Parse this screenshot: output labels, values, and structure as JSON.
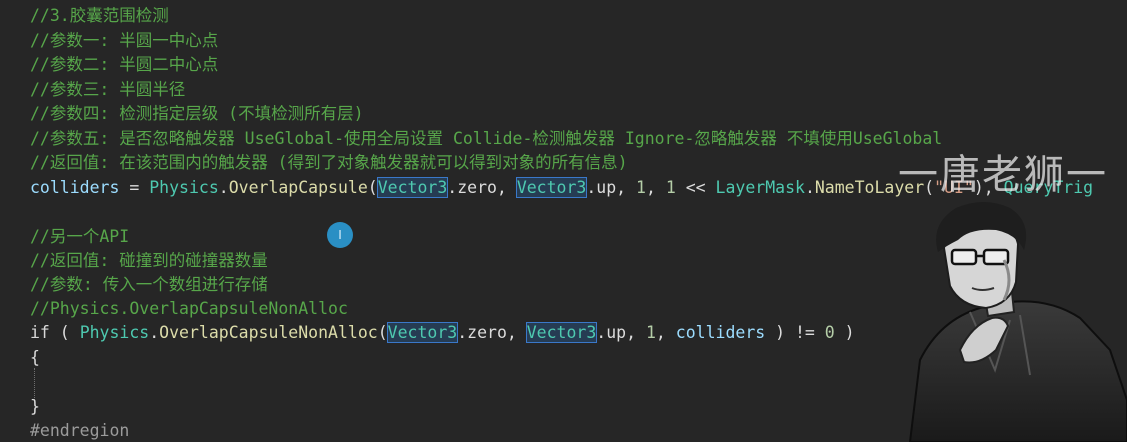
{
  "code": {
    "l1": "//3.胶囊范围检测",
    "l2": "//参数一: 半圆一中心点",
    "l3": "//参数二: 半圆二中心点",
    "l4": "//参数三: 半圆半径",
    "l5": "//参数四: 检测指定层级 (不填检测所有层)",
    "l6": "//参数五: 是否忽略触发器 UseGlobal-使用全局设置 Collide-检测触发器 Ignore-忽略触发器 不填使用UseGlobal",
    "l7": "//返回值: 在该范围内的触发器 (得到了对象触发器就可以得到对象的所有信息)",
    "l8": {
      "colliders": "colliders",
      "eq": " = ",
      "physics": "Physics",
      "dot1": ".",
      "method": "OverlapCapsule",
      "paren": "(",
      "vec1": "Vector3",
      "zero": ".zero, ",
      "vec2": "Vector3",
      "up": ".up, ",
      "num1": "1",
      "sep1": ", ",
      "num2": "1",
      "shift": " << ",
      "layermask": "LayerMask",
      "dot2": ".",
      "nametolayer": "NameToLayer",
      "paren2": "(",
      "str": "\"UI\"",
      "tail": "), ",
      "querytrig": "QueryTrig"
    },
    "l10": "//另一个API",
    "l11": "//返回值: 碰撞到的碰撞器数量",
    "l12": "//参数: 传入一个数组进行存储",
    "l13": "//Physics.OverlapCapsuleNonAlloc",
    "l14": {
      "if": "if",
      "open": " ( ",
      "physics": "Physics",
      "dot1": ".",
      "method": "OverlapCapsuleNonAlloc",
      "paren": "(",
      "vec1": "Vector3",
      "zero": ".zero, ",
      "vec2": "Vector3",
      "up": ".up, ",
      "num1": "1",
      "sep": ", ",
      "colliders": "colliders",
      "neq": " ) != ",
      "num0": "0",
      "close": " )"
    },
    "l15": "{",
    "l16": "}",
    "l17": "#endregion"
  },
  "cursor_label": "I",
  "watermark": "一唐老狮一"
}
